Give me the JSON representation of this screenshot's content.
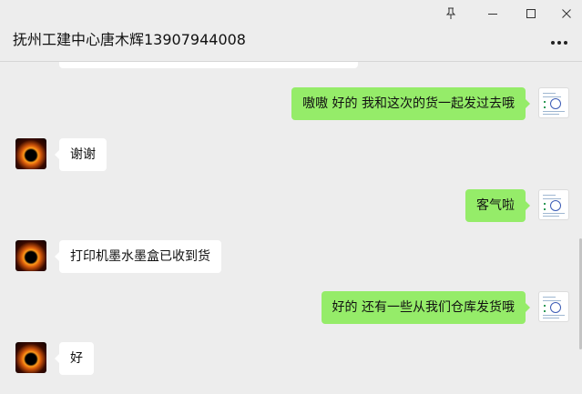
{
  "window": {
    "title": "抚州工建中心唐木辉13907944008"
  },
  "controls": {
    "pin_icon": "pin-icon",
    "minimize_icon": "minimize-icon",
    "maximize_icon": "maximize-icon",
    "close_icon": "close-icon",
    "more_icon": "more-icon"
  },
  "messages": [
    {
      "side": "right",
      "text": "嗷嗷 好的 我和这次的货一起发过去哦"
    },
    {
      "side": "left",
      "text": "谢谢"
    },
    {
      "side": "right",
      "text": "客气啦"
    },
    {
      "side": "left",
      "text": "打印机墨水墨盒已收到货"
    },
    {
      "side": "right",
      "text": "好的 还有一些从我们仓库发货哦"
    },
    {
      "side": "left",
      "text": "好"
    }
  ],
  "colors": {
    "background": "#ededed",
    "sent_bubble": "#95ec69",
    "received_bubble": "#ffffff"
  }
}
